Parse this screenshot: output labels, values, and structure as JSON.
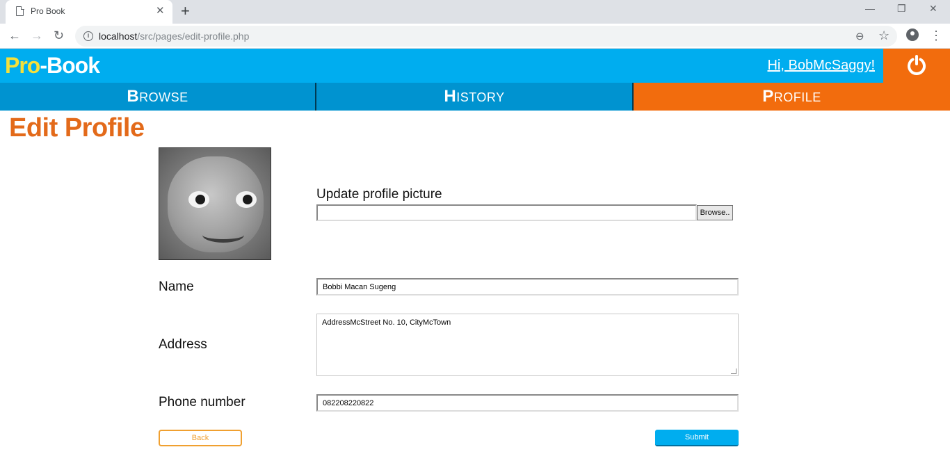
{
  "browser": {
    "tab_title": "Pro Book",
    "url_host": "localhost",
    "url_path": "/src/pages/edit-profile.php"
  },
  "header": {
    "logo_pro": "Pro",
    "logo_dash": "-",
    "logo_book": "Book",
    "greeting": "Hi, BobMcSaggy!"
  },
  "nav": {
    "browse": {
      "cap": "B",
      "rest": "ROWSE"
    },
    "history": {
      "cap": "H",
      "rest": "ISTORY"
    },
    "profile": {
      "cap": "P",
      "rest": "ROFILE"
    }
  },
  "page": {
    "title": "Edit Profile",
    "update_picture_label": "Update profile picture",
    "browse_label": "Browse..",
    "name_label": "Name",
    "name_value": "Bobbi Macan Sugeng",
    "address_label": "Address",
    "address_value": "AddressMcStreet No. 10, CityMcTown",
    "phone_label": "Phone number",
    "phone_value": "082208220822",
    "back_label": "Back",
    "submit_label": "Submit"
  },
  "colors": {
    "header_blue": "#00adef",
    "nav_blue": "#0093d0",
    "accent_orange": "#f26c0d",
    "logo_yellow": "#f5e03a"
  }
}
